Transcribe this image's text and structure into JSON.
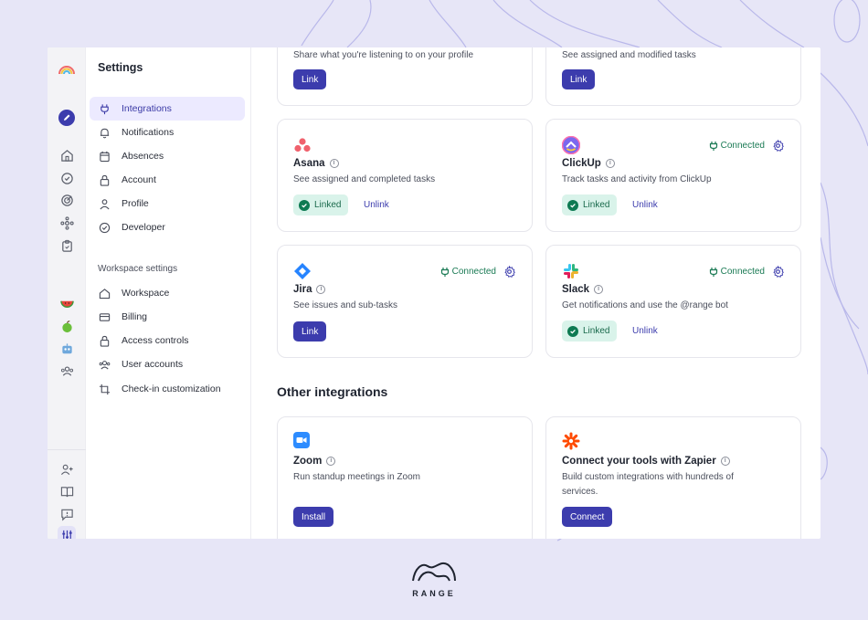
{
  "rail": {
    "icons": [
      "rainbow-logo",
      "edit-icon",
      "home-icon",
      "check-circle-icon",
      "target-icon",
      "graph-icon",
      "clipboard-icon",
      "watermelon-icon",
      "apple-icon",
      "robot-icon",
      "team-icon",
      "add-user-icon",
      "book-icon",
      "feedback-icon",
      "settings-sliders-icon"
    ]
  },
  "nav": {
    "title": "Settings",
    "items": [
      {
        "label": "Integrations",
        "icon": "plug-icon",
        "active": true
      },
      {
        "label": "Notifications",
        "icon": "bell-icon"
      },
      {
        "label": "Absences",
        "icon": "calendar-icon"
      },
      {
        "label": "Account",
        "icon": "lock-icon"
      },
      {
        "label": "Profile",
        "icon": "person-icon"
      },
      {
        "label": "Developer",
        "icon": "check-circle-icon"
      }
    ],
    "workspace_section": "Workspace settings",
    "workspace_items": [
      {
        "label": "Workspace",
        "icon": "home-icon"
      },
      {
        "label": "Billing",
        "icon": "card-icon"
      },
      {
        "label": "Access controls",
        "icon": "lock-icon"
      },
      {
        "label": "User accounts",
        "icon": "users-icon"
      },
      {
        "label": "Check-in customization",
        "icon": "crop-icon"
      }
    ]
  },
  "cards": {
    "spotify": {
      "desc": "Share what you're listening to on your profile",
      "button": "Link"
    },
    "github": {
      "desc": "See assigned and modified tasks",
      "button": "Link"
    },
    "asana": {
      "name": "Asana",
      "desc": "See assigned and completed tasks",
      "linked": "Linked",
      "unlink": "Unlink"
    },
    "clickup": {
      "name": "ClickUp",
      "desc": "Track tasks and activity from ClickUp",
      "status": "Connected",
      "linked": "Linked",
      "unlink": "Unlink"
    },
    "jira": {
      "name": "Jira",
      "desc": "See issues and sub-tasks",
      "status": "Connected",
      "button": "Link"
    },
    "slack": {
      "name": "Slack",
      "desc": "Get notifications and use the @range bot",
      "status": "Connected",
      "linked": "Linked",
      "unlink": "Unlink"
    },
    "zoom": {
      "name": "Zoom",
      "desc": "Run standup meetings in Zoom",
      "button": "Install"
    },
    "zapier": {
      "name": "Connect your tools with Zapier",
      "desc": "Build custom integrations with hundreds of services.",
      "button": "Connect"
    }
  },
  "other_title": "Other integrations",
  "brand": {
    "word": "RANGE"
  },
  "colors": {
    "accent": "#3c3cad",
    "linked_bg": "#d9f3ea",
    "connected": "#1a7a54",
    "background": "#e7e6f7"
  }
}
